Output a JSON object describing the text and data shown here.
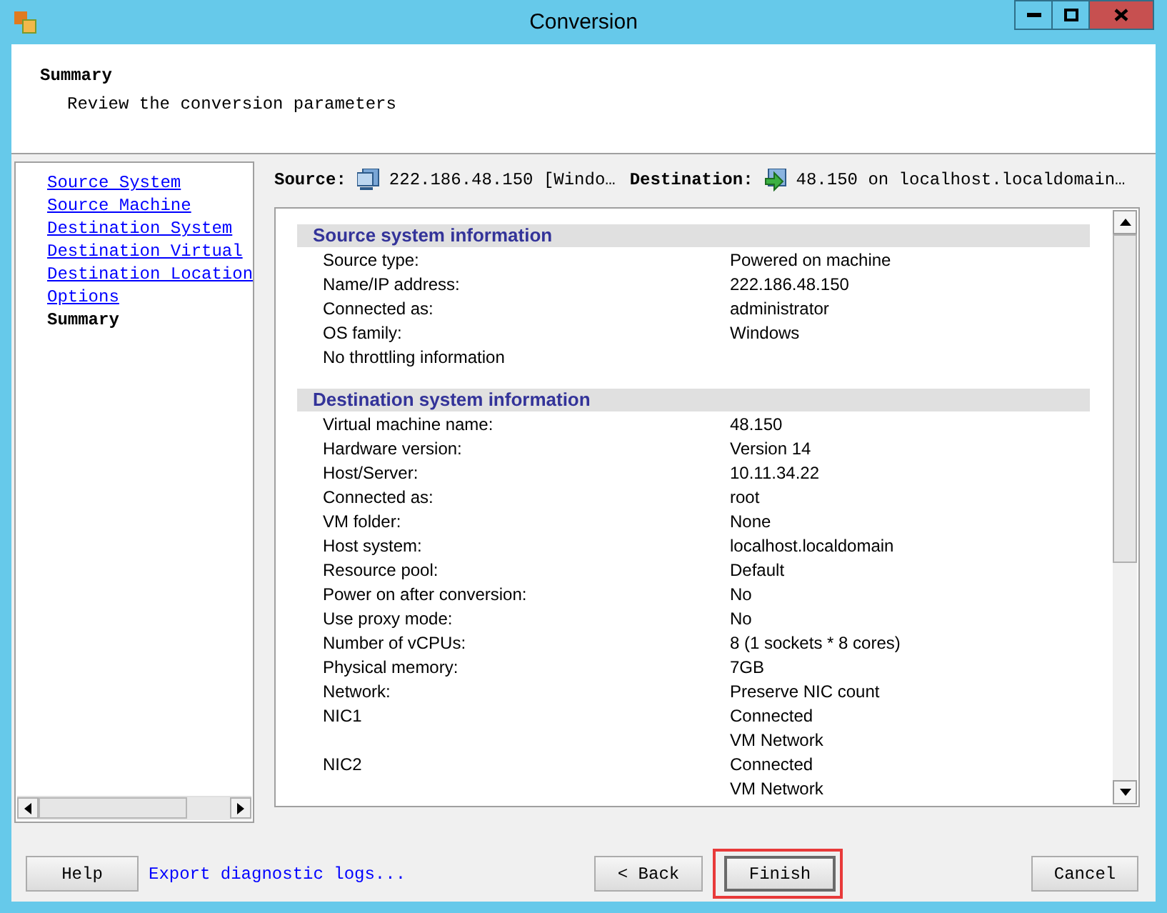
{
  "window": {
    "title": "Conversion"
  },
  "header": {
    "title": "Summary",
    "subtitle": "Review the conversion parameters"
  },
  "steps": [
    {
      "label": "Source System",
      "selected": false
    },
    {
      "label": "Source Machine",
      "selected": false
    },
    {
      "label": "Destination System",
      "selected": false
    },
    {
      "label": "Destination Virtual",
      "selected": false
    },
    {
      "label": "Destination Location",
      "selected": false
    },
    {
      "label": "Options",
      "selected": false
    },
    {
      "label": "Summary",
      "selected": true
    }
  ],
  "connection": {
    "source_label": "Source:",
    "source": "222.186.48.150 [Windo…",
    "destination_label": "Destination:",
    "destination": "48.150 on localhost.localdomain…"
  },
  "sections": [
    {
      "title": "Source system information",
      "rows": [
        {
          "label": "Source type:",
          "values": [
            "Powered on machine"
          ]
        },
        {
          "label": "Name/IP address:",
          "values": [
            "222.186.48.150"
          ]
        },
        {
          "label": "Connected as:",
          "values": [
            "administrator"
          ]
        },
        {
          "label": "OS family:",
          "values": [
            "Windows"
          ]
        },
        {
          "label": "No throttling information",
          "values": []
        }
      ]
    },
    {
      "title": "Destination system information",
      "rows": [
        {
          "label": "Virtual machine name:",
          "values": [
            "48.150"
          ]
        },
        {
          "label": "Hardware version:",
          "values": [
            "Version 14"
          ]
        },
        {
          "label": "Host/Server:",
          "values": [
            "10.11.34.22"
          ]
        },
        {
          "label": "Connected as:",
          "values": [
            "root"
          ]
        },
        {
          "label": "VM folder:",
          "values": [
            "None"
          ]
        },
        {
          "label": "Host system:",
          "values": [
            "localhost.localdomain"
          ]
        },
        {
          "label": "Resource pool:",
          "values": [
            "Default"
          ]
        },
        {
          "label": "Power on after conversion:",
          "values": [
            "No"
          ]
        },
        {
          "label": "Use proxy mode:",
          "values": [
            "No"
          ]
        },
        {
          "label": "Number of vCPUs:",
          "values": [
            "8 (1 sockets * 8 cores)"
          ]
        },
        {
          "label": "Physical memory:",
          "values": [
            "7GB"
          ]
        },
        {
          "label": "Network:",
          "values": [
            "Preserve NIC count"
          ]
        },
        {
          "label": "NIC1",
          "values": [
            "Connected",
            "VM Network"
          ]
        },
        {
          "label": "NIC2",
          "values": [
            "Connected",
            "VM Network"
          ]
        }
      ]
    }
  ],
  "footer": {
    "help": "Help",
    "export_link": "Export diagnostic logs...",
    "back": "< Back",
    "finish": "Finish",
    "finish_highlighted": true,
    "cancel": "Cancel"
  }
}
